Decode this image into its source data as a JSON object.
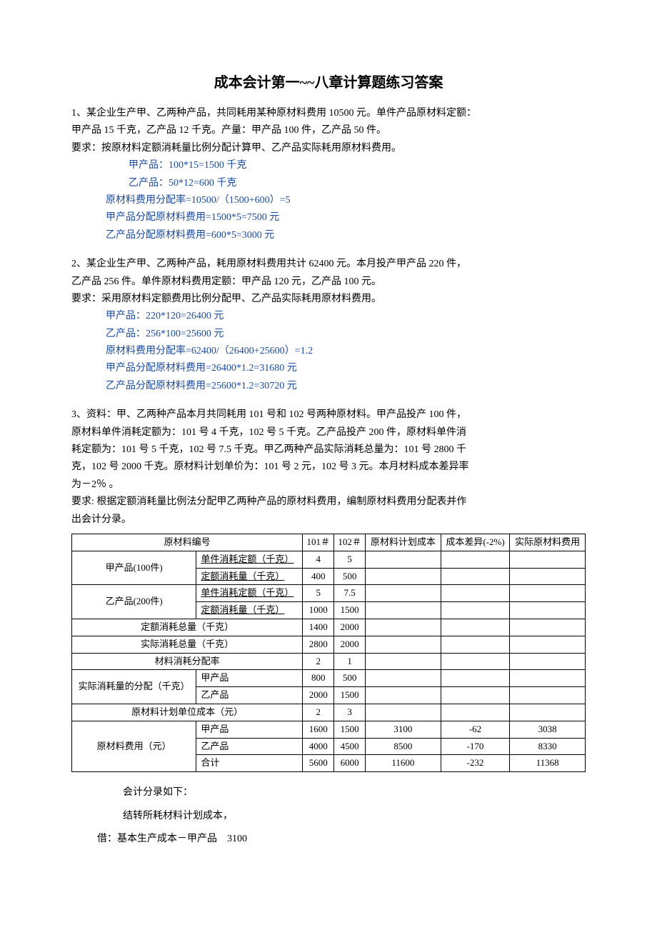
{
  "title": "成本会计第一~~八章计算题练习答案",
  "q1": {
    "line1": "1、某企业生产甲、乙两种产品，共同耗用某种原材料费用 10500 元。单件产品原材料定额：",
    "line2": "甲产品 15 千克，乙产品 12 千克。产量：甲产品 100 件，乙产品 50 件。",
    "line3": "要求：按原材料定额消耗量比例分配计算甲、乙产品实际耗用原材料费用。",
    "a1": "甲产品：100*15=1500 千克",
    "a2": "乙产品：50*12=600 千克",
    "a3": "原材料费用分配率=10500/（1500+600）=5",
    "a4": "甲产品分配原材料费用=1500*5=7500 元",
    "a5": "乙产品分配原材料费用=600*5=3000 元"
  },
  "q2": {
    "line1": "2、某企业生产甲、乙两种产品，耗用原材料费用共计 62400 元。本月投产甲产品 220 件，",
    "line2": "乙产品 256 件。单件原材料费用定额：甲产品 120 元，乙产品 100 元。",
    "line3": "要求：采用原材料定额费用比例分配甲、乙产品实际耗用原材料费用。",
    "a1": "甲产品：220*120=26400 元",
    "a2": "乙产品：256*100=25600 元",
    "a3": "原材料费用分配率=62400/（26400+25600）=1.2",
    "a4": "甲产品分配原材料费用=26400*1.2=31680 元",
    "a5": "乙产品分配原材料费用=25600*1.2=30720 元"
  },
  "q3": {
    "line1": "3、资料：甲、乙两种产品本月共同耗用 101 号和 102 号两种原材料。甲产品投产 100 件，",
    "line2": "原材料单件消耗定额为：101 号 4 千克，102 号 5 千克。乙产品投产 200 件，原材料单件消",
    "line3": "耗定额为：101 号 5 千克，102 号 7.5 千克。甲乙两种产品实际消耗总量为：101 号 2800 千",
    "line4": "克，102 号 2000 千克。原材料计划单价为：101 号 2 元，102 号 3 元。本月材料成本差异率",
    "line5": "为－2％ 。",
    "line6": "要求: 根据定额消耗量比例法分配甲乙两种产品的原材料费用，编制原材料费用分配表并作",
    "line7": "出会计分录。"
  },
  "table": {
    "h_material": "原材料编号",
    "h_101": "101＃",
    "h_102": "102＃",
    "h_plan": "原材料计划成本",
    "h_diff": "成本差异(-2%)",
    "h_actual": "实际原材料费用",
    "prodA": "甲产品(100件)",
    "prodB": "乙产品(200件)",
    "unit_quota": "单件消耗定额（千克）",
    "quota_consume": "定额消耗量（千克）",
    "quota_total": "定额消耗总量（千克）",
    "actual_total": "实际消耗总量（千克）",
    "consume_rate": "材料消耗分配率",
    "actual_alloc_label": "实际消耗量的分配（千克）",
    "prodA_lbl": "甲产品",
    "prodB_lbl": "乙产品",
    "plan_unit_cost": "原材料计划单位成本（元）",
    "fee_label": "原材料费用（元）",
    "total_lbl": "合计",
    "r": {
      "a_unit_101": "4",
      "a_unit_102": "5",
      "a_quota_101": "400",
      "a_quota_102": "500",
      "b_unit_101": "5",
      "b_unit_102": "7.5",
      "b_quota_101": "1000",
      "b_quota_102": "1500",
      "quota_tot_101": "1400",
      "quota_tot_102": "2000",
      "actual_tot_101": "2800",
      "actual_tot_102": "2000",
      "rate_101": "2",
      "rate_102": "1",
      "alloc_a_101": "800",
      "alloc_a_102": "500",
      "alloc_b_101": "2000",
      "alloc_b_102": "1500",
      "unitcost_101": "2",
      "unitcost_102": "3",
      "fee_a_101": "1600",
      "fee_a_102": "1500",
      "fee_a_plan": "3100",
      "fee_a_diff": "-62",
      "fee_a_act": "3038",
      "fee_b_101": "4000",
      "fee_b_102": "4500",
      "fee_b_plan": "8500",
      "fee_b_diff": "-170",
      "fee_b_act": "8330",
      "fee_t_101": "5600",
      "fee_t_102": "6000",
      "fee_t_plan": "11600",
      "fee_t_diff": "-232",
      "fee_t_act": "11368"
    }
  },
  "post": {
    "l1": "会计分录如下：",
    "l2": "结转所耗材料计划成本，",
    "l3": "借：基本生产成本－甲产品　3100"
  }
}
